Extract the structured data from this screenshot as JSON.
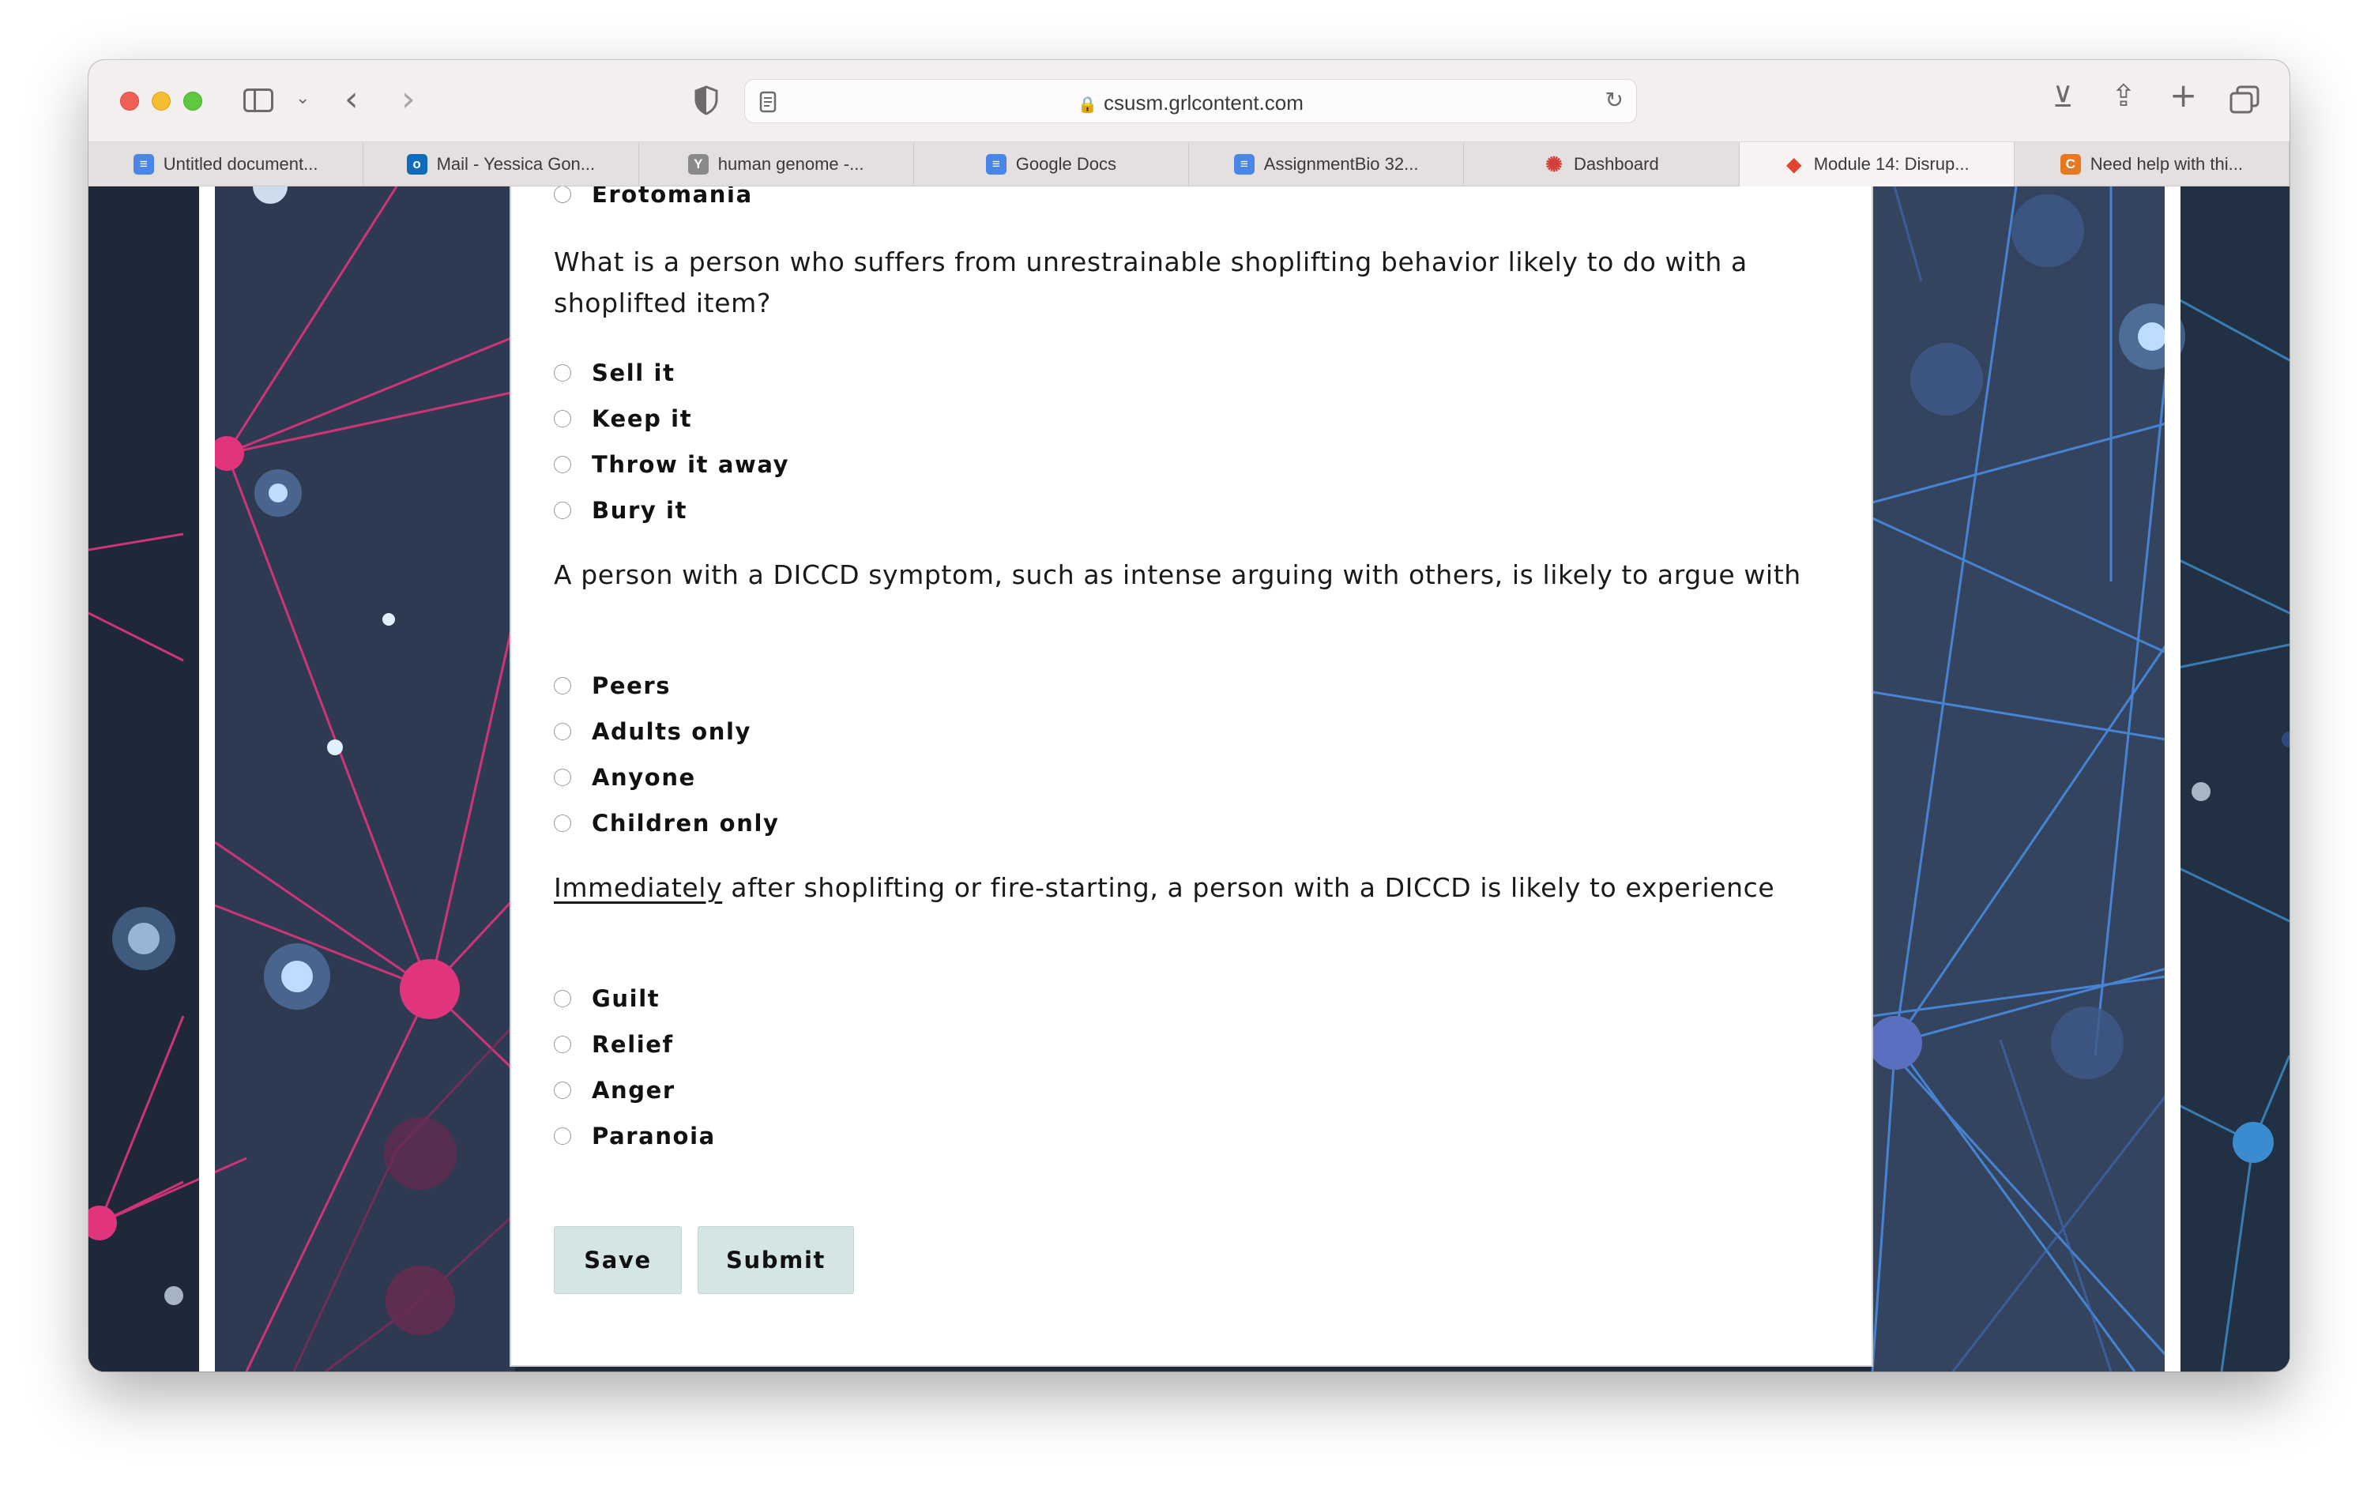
{
  "browser": {
    "url": "csusm.grlcontent.com",
    "tabs": [
      {
        "label": "Untitled document...",
        "icon": "google-docs-icon",
        "color": "#4a86e8"
      },
      {
        "label": "Mail - Yessica Gon...",
        "icon": "outlook-icon",
        "color": "#0f6cbd"
      },
      {
        "label": "human genome -...",
        "icon": "yahoo-icon",
        "color": "#8a8a8a"
      },
      {
        "label": "Google Docs",
        "icon": "google-docs-icon",
        "color": "#4a86e8"
      },
      {
        "label": "AssignmentBio 32...",
        "icon": "google-docs-icon",
        "color": "#4a86e8"
      },
      {
        "label": "Dashboard",
        "icon": "dashboard-icon",
        "color": "#d43f3a"
      },
      {
        "label": "Module 14: Disrup...",
        "icon": "module-icon",
        "color": "#e0452f"
      },
      {
        "label": "Need help with thi...",
        "icon": "chegg-icon",
        "color": "#e87722"
      }
    ]
  },
  "quiz": {
    "prev_option": "Erotomania",
    "questions": [
      {
        "text": "What is a person who suffers from unrestrainable shoplifting behavior likely to do with a shoplifted item?",
        "options": [
          "Sell it",
          "Keep it",
          "Throw it away",
          "Bury it"
        ]
      },
      {
        "text": "A person with a DICCD symptom, such as intense arguing with others, is likely to argue with",
        "options": [
          "Peers",
          "Adults only",
          "Anyone",
          "Children only"
        ]
      },
      {
        "text_emph": "Immediately",
        "text_rest": " after shoplifting or fire-starting, a person with a DICCD is likely to experience",
        "options": [
          "Guilt",
          "Relief",
          "Anger",
          "Paranoia"
        ]
      }
    ],
    "save_label": "Save",
    "submit_label": "Submit"
  }
}
